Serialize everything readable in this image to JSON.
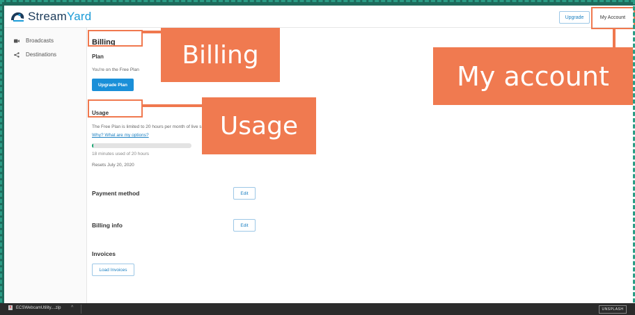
{
  "header": {
    "logo_prefix": "Stream",
    "logo_suffix": "Yard",
    "upgrade_label": "Upgrade",
    "my_account_label": "My Account"
  },
  "sidebar": {
    "items": [
      {
        "label": "Broadcasts",
        "icon": "video-camera-icon"
      },
      {
        "label": "Destinations",
        "icon": "share-icon"
      }
    ]
  },
  "billing": {
    "title": "Billing",
    "plan_heading": "Plan",
    "plan_text": "You're on the Free Plan",
    "upgrade_plan_label": "Upgrade Plan",
    "usage_heading": "Usage",
    "usage_limit_text": "The Free Plan is limited to 20 hours per month of live s",
    "options_link": "Why? What are my options?",
    "usage_fraction": 0.015,
    "usage_text": "18 minutes used of 20 hours",
    "resets_text": "Resets July 20, 2020",
    "payment_heading": "Payment method",
    "payment_edit_label": "Edit",
    "billing_info_heading": "Billing info",
    "billing_info_edit_label": "Edit",
    "invoices_heading": "Invoices",
    "load_invoices_label": "Load Invoices"
  },
  "callouts": {
    "billing": "Billing",
    "usage": "Usage",
    "my_account": "My account"
  },
  "taskbar": {
    "download_file": "ECSWebcamUtility....zip",
    "badge": "UNSPLASH"
  },
  "colors": {
    "accent": "#1a8fd8",
    "callout": "#f07a50",
    "progress": "#13a36e",
    "frame": "#2a9c85"
  }
}
